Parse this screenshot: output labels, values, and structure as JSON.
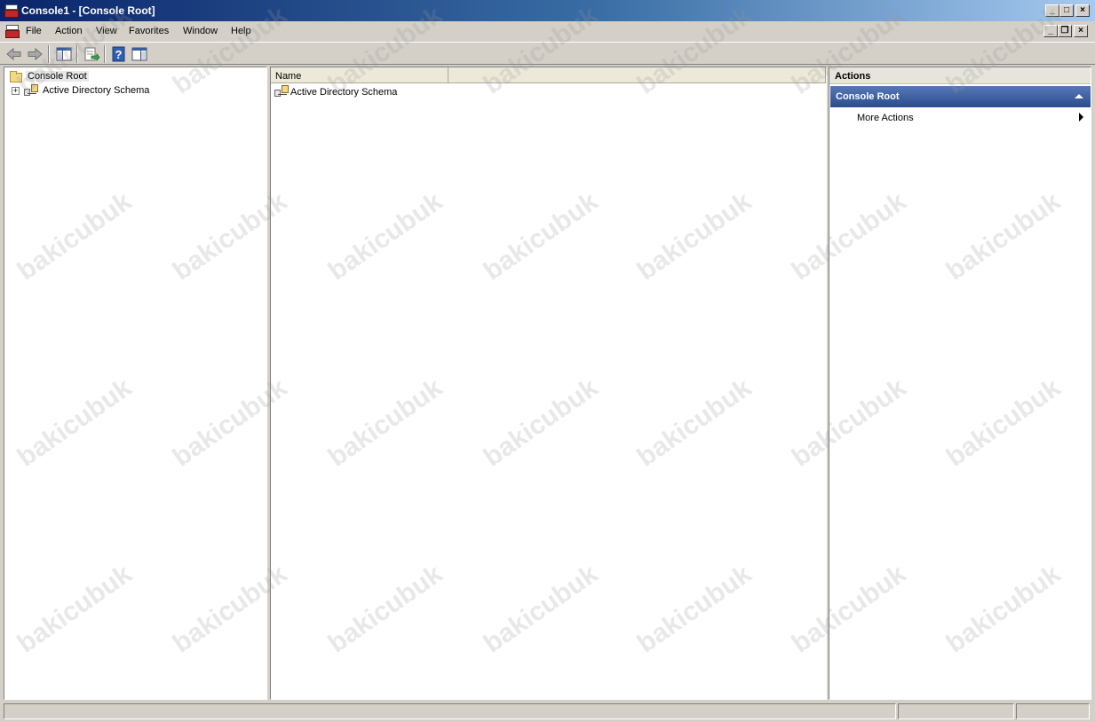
{
  "window": {
    "title": "Console1 - [Console Root]",
    "caption_buttons": {
      "minimize": "_",
      "maximize": "□",
      "close": "×"
    },
    "mdi_buttons": {
      "minimize": "_",
      "restore": "❐",
      "close": "×"
    }
  },
  "menu": {
    "items": [
      {
        "label": "File"
      },
      {
        "label": "Action"
      },
      {
        "label": "View"
      },
      {
        "label": "Favorites"
      },
      {
        "label": "Window"
      },
      {
        "label": "Help"
      }
    ]
  },
  "toolbar": {
    "buttons": [
      {
        "icon": "back-arrow-icon"
      },
      {
        "icon": "forward-arrow-icon"
      },
      {
        "icon": "show-hide-console-tree-icon"
      },
      {
        "icon": "export-list-icon"
      },
      {
        "icon": "help-icon"
      },
      {
        "icon": "show-hide-action-pane-icon"
      }
    ]
  },
  "tree": {
    "root": {
      "label": "Console Root",
      "icon": "folder-icon"
    },
    "children": [
      {
        "label": "Active Directory Schema",
        "icon": "schema-icon",
        "expander": "+"
      }
    ]
  },
  "list": {
    "columns": [
      {
        "label": "Name"
      },
      {
        "label": ""
      }
    ],
    "rows": [
      {
        "name": "Active Directory Schema",
        "icon": "schema-icon"
      }
    ]
  },
  "actions": {
    "title": "Actions",
    "section": "Console Root",
    "items": [
      {
        "label": "More Actions"
      }
    ]
  },
  "watermark": {
    "text": "bakicubuk"
  },
  "colors": {
    "titlebar_start": "#0a246a",
    "titlebar_end": "#a6caf0",
    "actions_section": "#2a4c8c",
    "chrome": "#d4d0c8"
  }
}
